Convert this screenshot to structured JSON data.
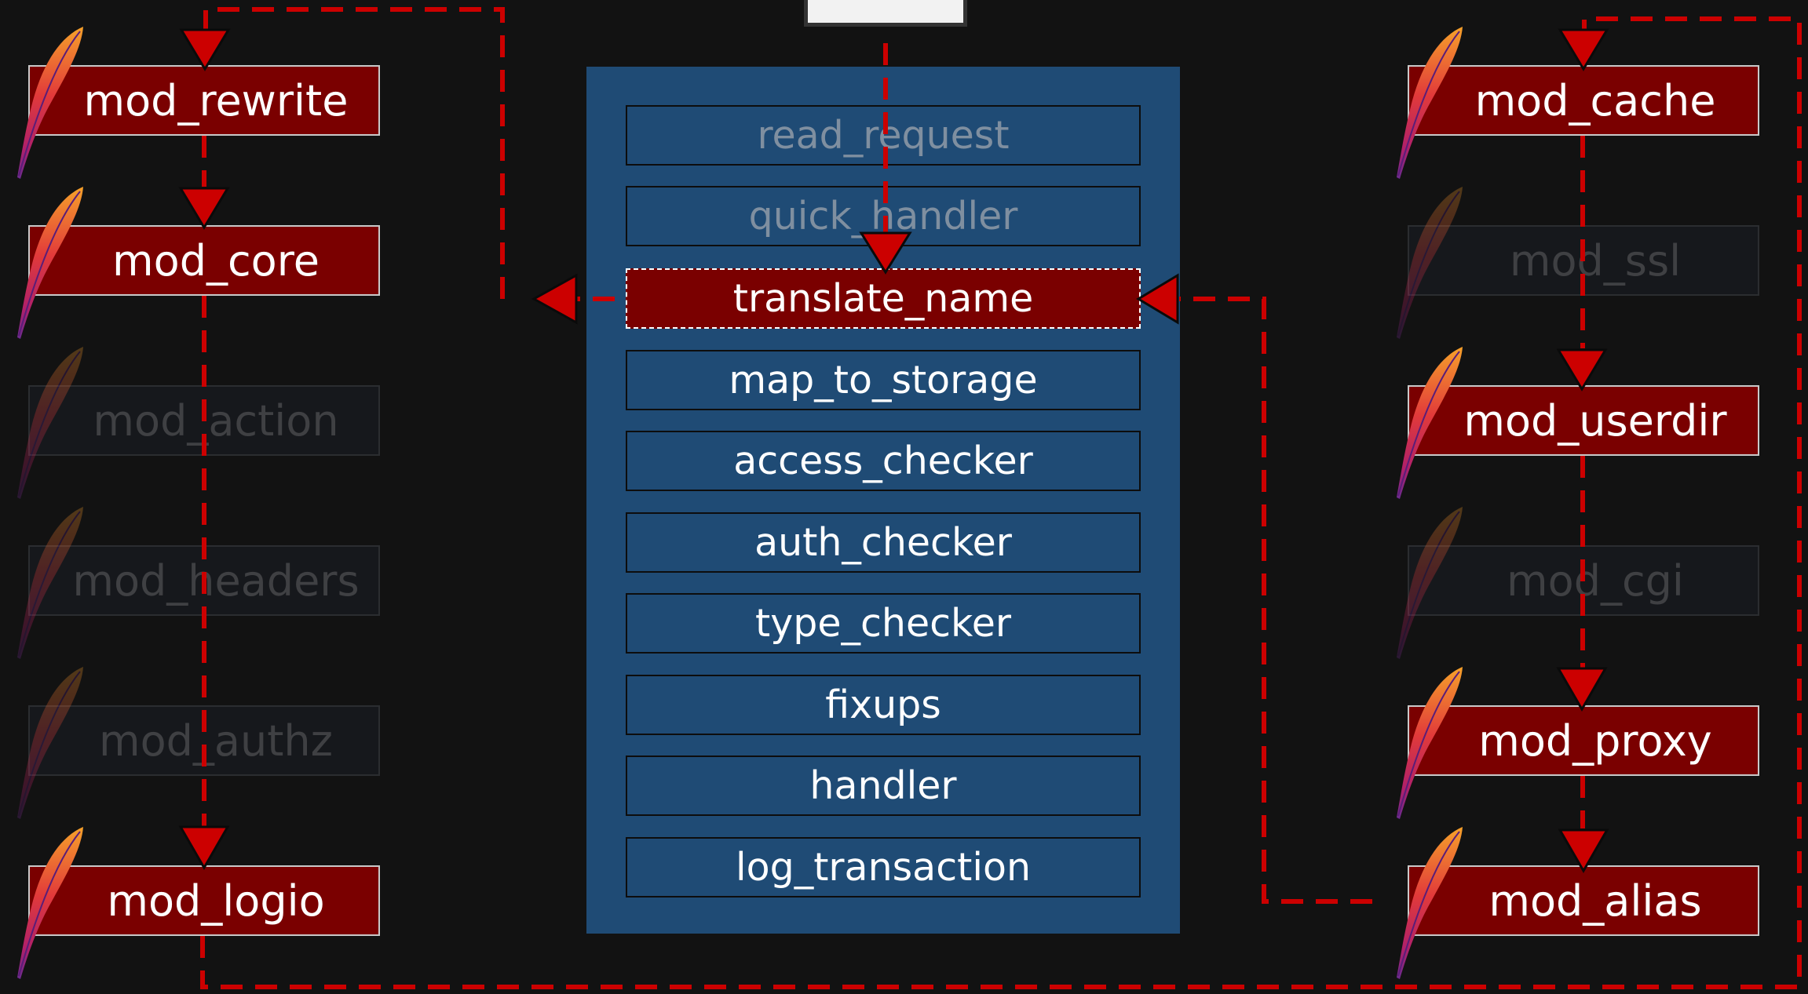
{
  "colors": {
    "background": "#121212",
    "panel": "#1f4b75",
    "active": "#7a0000",
    "arrow": "#cc0000"
  },
  "hooks": [
    {
      "label": "read_request",
      "state": "dim"
    },
    {
      "label": "quick_handler",
      "state": "dim"
    },
    {
      "label": "translate_name",
      "state": "active"
    },
    {
      "label": "map_to_storage",
      "state": "normal"
    },
    {
      "label": "access_checker",
      "state": "normal"
    },
    {
      "label": "auth_checker",
      "state": "normal"
    },
    {
      "label": "type_checker",
      "state": "normal"
    },
    {
      "label": "fixups",
      "state": "normal"
    },
    {
      "label": "handler",
      "state": "normal"
    },
    {
      "label": "log_transaction",
      "state": "normal"
    }
  ],
  "left_modules": [
    {
      "label": "mod_rewrite",
      "active": true
    },
    {
      "label": "mod_core",
      "active": true
    },
    {
      "label": "mod_action",
      "active": false
    },
    {
      "label": "mod_headers",
      "active": false
    },
    {
      "label": "mod_authz",
      "active": false
    },
    {
      "label": "mod_logio",
      "active": true
    }
  ],
  "right_modules": [
    {
      "label": "mod_cache",
      "active": true
    },
    {
      "label": "mod_ssl",
      "active": false
    },
    {
      "label": "mod_userdir",
      "active": true
    },
    {
      "label": "mod_cgi",
      "active": false
    },
    {
      "label": "mod_proxy",
      "active": true
    },
    {
      "label": "mod_alias",
      "active": true
    }
  ]
}
